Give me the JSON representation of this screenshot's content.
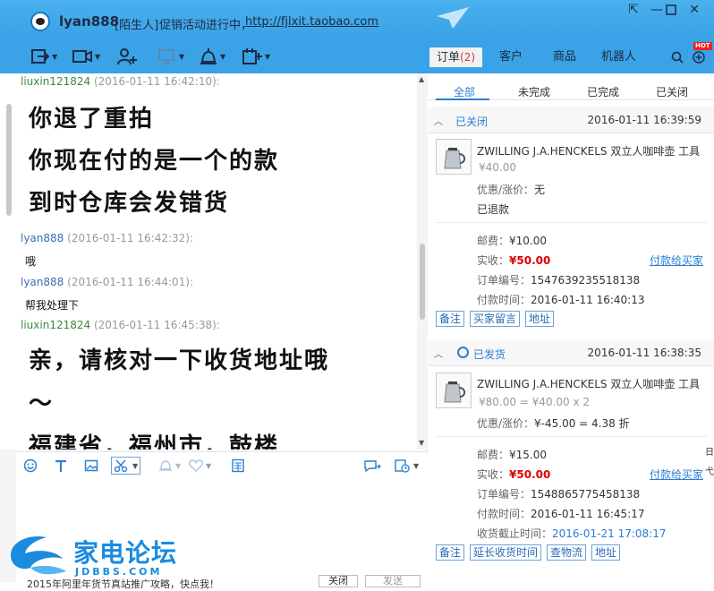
{
  "title": {
    "user": "lyan888",
    "tag": "[陌生人]",
    "promo": "促销活动进行中，",
    "link": "http://fjlxit.taobao.com"
  },
  "right_tabs": [
    {
      "label": "订单",
      "count": "(2)"
    },
    {
      "label": "客户"
    },
    {
      "label": "商品"
    },
    {
      "label": "机器人"
    }
  ],
  "hot_badge": "HOT",
  "messages": [
    {
      "who": "liuxin121824",
      "when": "(2016-01-11 16:42:10):"
    },
    {
      "line1": "你退了重拍",
      "line2": "你现在付的是一个的款",
      "line3": "到时仓库会发错货"
    },
    {
      "who": "lyan888",
      "when": "(2016-01-11 16:42:32):",
      "text": "哦"
    },
    {
      "who": "lyan888",
      "when": "(2016-01-11 16:44:01):",
      "text": "帮我处理下"
    },
    {
      "who": "liuxin121824",
      "when": "(2016-01-11 16:45:38):"
    },
    {
      "line1": "亲，请核对一下收货地址哦",
      "line2": "～",
      "line3": "福建省，福州市，鼓楼"
    }
  ],
  "watermark": {
    "text": "家电论坛",
    "sub": "JDBBS.COM"
  },
  "bottom": {
    "notice": "2015年阿里年货节真站推广攻略，快点我！",
    "close": "关闭",
    "send": "发送"
  },
  "subtabs": [
    "全部",
    "未完成",
    "已完成",
    "已关闭"
  ],
  "orders": [
    {
      "status": "已关闭",
      "time": "2016-01-11 16:39:59",
      "product": "ZWILLING J.A.HENCKELS 双立人咖啡壶 工具",
      "price": "¥40.00",
      "discount_label": "优惠/涨价：",
      "discount": "无",
      "refund": "已退款",
      "postage_label": "邮费：",
      "postage": "¥10.00",
      "paid_label": "实收：",
      "paid": "¥50.00",
      "pay_link": "付款给买家",
      "order_no_label": "订单编号：",
      "order_no": "1547639235518138",
      "pay_time_label": "付款时间：",
      "pay_time": "2016-01-11 16:40:13",
      "actions": [
        "备注",
        "买家留言",
        "地址"
      ]
    },
    {
      "status": "已发货",
      "time": "2016-01-11 16:38:35",
      "product": "ZWILLING J.A.HENCKELS 双立人咖啡壶 工具",
      "price": "¥80.00 = ¥40.00 x 2",
      "discount_label": "优惠/涨价：",
      "discount": "¥-45.00 = 4.38 折",
      "postage_label": "邮费：",
      "postage": "¥15.00",
      "paid_label": "实收：",
      "paid": "¥50.00",
      "pay_link": "付款给买家",
      "order_no_label": "订单编号：",
      "order_no": "1548865775458138",
      "pay_time_label": "付款时间：",
      "pay_time": "2016-01-11 16:45:17",
      "deadline_label": "收货截止时间：",
      "deadline": "2016-01-21 17:08:17",
      "actions": [
        "备注",
        "延长收货时间",
        "查物流",
        "地址"
      ]
    }
  ],
  "edge_text": [
    "日",
    "弋"
  ]
}
